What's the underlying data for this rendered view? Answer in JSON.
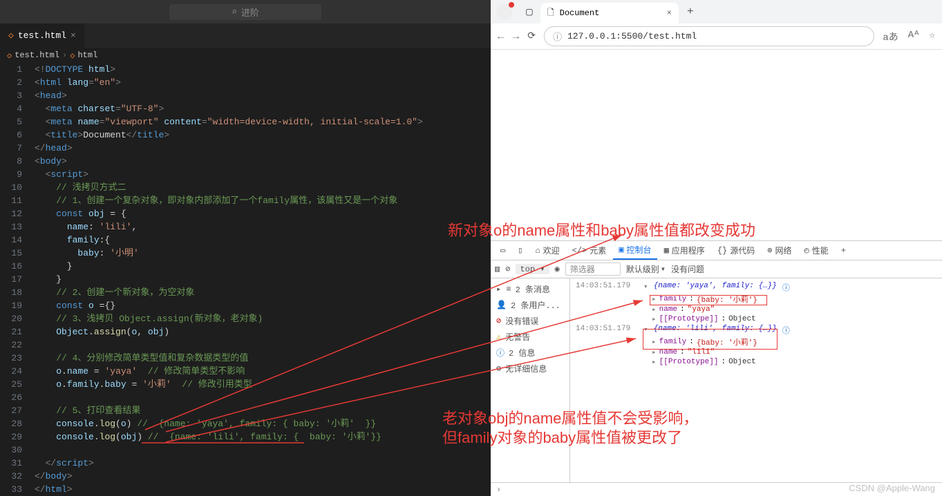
{
  "vscode": {
    "search_placeholder": "进阶",
    "tab_name": "test.html",
    "breadcrumb": [
      "test.html",
      "html"
    ],
    "code_lines": [
      {
        "n": 1,
        "html": "<span class='punc'>&lt;!</span><span class='tag'>DOCTYPE</span> <span class='attr'>html</span><span class='punc'>&gt;</span>"
      },
      {
        "n": 2,
        "html": "<span class='punc'>&lt;</span><span class='tag'>html</span> <span class='attr'>lang</span><span class='punc'>=</span><span class='str'>\"en\"</span><span class='punc'>&gt;</span>"
      },
      {
        "n": 3,
        "html": "<span class='punc'>&lt;</span><span class='tag'>head</span><span class='punc'>&gt;</span>"
      },
      {
        "n": 4,
        "html": "  <span class='punc'>&lt;</span><span class='tag'>meta</span> <span class='attr'>charset</span><span class='punc'>=</span><span class='str'>\"UTF-8\"</span><span class='punc'>&gt;</span>"
      },
      {
        "n": 5,
        "html": "  <span class='punc'>&lt;</span><span class='tag'>meta</span> <span class='attr'>name</span><span class='punc'>=</span><span class='str'>\"viewport\"</span> <span class='attr'>content</span><span class='punc'>=</span><span class='str'>\"width=device-width, initial-scale=1.0\"</span><span class='punc'>&gt;</span>"
      },
      {
        "n": 6,
        "html": "  <span class='punc'>&lt;</span><span class='tag'>title</span><span class='punc'>&gt;</span>Document<span class='punc'>&lt;/</span><span class='tag'>title</span><span class='punc'>&gt;</span>"
      },
      {
        "n": 7,
        "html": "<span class='punc'>&lt;/</span><span class='tag'>head</span><span class='punc'>&gt;</span>"
      },
      {
        "n": 8,
        "html": "<span class='punc'>&lt;</span><span class='tag'>body</span><span class='punc'>&gt;</span>"
      },
      {
        "n": 9,
        "html": "  <span class='punc'>&lt;</span><span class='tag'>script</span><span class='punc'>&gt;</span>"
      },
      {
        "n": 10,
        "html": "    <span class='cmt'>// 浅拷贝方式二</span>"
      },
      {
        "n": 11,
        "html": "    <span class='cmt'>// 1、创建一个复杂对象，即对象内部添加了一个family属性，该属性又是一个对象</span>"
      },
      {
        "n": 12,
        "html": "    <span class='const'>const</span> <span class='var'>obj</span> = {"
      },
      {
        "n": 13,
        "html": "      <span class='prop'>name</span>: <span class='str'>'lili'</span>,"
      },
      {
        "n": 14,
        "html": "      <span class='prop'>family</span>:{"
      },
      {
        "n": 15,
        "html": "        <span class='prop'>baby</span>: <span class='str'>'小明'</span>"
      },
      {
        "n": 16,
        "html": "      }"
      },
      {
        "n": 17,
        "html": "    }"
      },
      {
        "n": 18,
        "html": "    <span class='cmt'>// 2、创建一个新对象，为空对象</span>"
      },
      {
        "n": 19,
        "html": "    <span class='const'>const</span> <span class='var'>o</span> ={}"
      },
      {
        "n": 20,
        "html": "    <span class='cmt'>// 3、浅拷贝 Object.assign(新对象，老对象)</span>"
      },
      {
        "n": 21,
        "html": "    <span class='var'>Object</span>.<span class='fn'>assign</span>(<span class='var'>o</span>, <span class='var'>obj</span>)"
      },
      {
        "n": 22,
        "html": ""
      },
      {
        "n": 23,
        "html": "    <span class='cmt'>// 4、分别修改简单类型值和复杂数据类型的值</span>"
      },
      {
        "n": 24,
        "html": "    <span class='var'>o</span>.<span class='prop'>name</span> = <span class='str'>'yaya'</span>  <span class='cmt'>// 修改简单类型不影响</span>"
      },
      {
        "n": 25,
        "html": "    <span class='var'>o</span>.<span class='prop'>family</span>.<span class='prop'>baby</span> = <span class='str'>'小莉'</span>  <span class='cmt'>// 修改引用类型</span>"
      },
      {
        "n": 26,
        "html": ""
      },
      {
        "n": 27,
        "html": "    <span class='cmt'>// 5、打印查看结果</span>"
      },
      {
        "n": 28,
        "html": "    <span class='var'>console</span>.<span class='fn'>log</span>(<span class='var'>o</span>) <span class='cmt'>//  {name: 'yaya', family: { baby: '小莉'  }}</span>"
      },
      {
        "n": 29,
        "html": "    <span class='var'>console</span>.<span class='fn'>log</span>(<span class='var'>obj</span>) <span class='cmt'>//  {name: 'lili', family: {  baby: '小莉'}}</span>"
      },
      {
        "n": 30,
        "html": ""
      },
      {
        "n": 31,
        "html": "  <span class='punc'>&lt;/</span><span class='tag'>script</span><span class='punc'>&gt;</span>"
      },
      {
        "n": 32,
        "html": "<span class='punc'>&lt;/</span><span class='tag'>body</span><span class='punc'>&gt;</span>"
      },
      {
        "n": 33,
        "html": "<span class='punc'>&lt;/</span><span class='tag'>html</span><span class='punc'>&gt;</span>"
      }
    ]
  },
  "browser": {
    "tab_title": "Document",
    "url": "127.0.0.1:5500/test.html",
    "reader_mode": "aあ"
  },
  "devtools": {
    "tabs": [
      "欢迎",
      "元素",
      "控制台",
      "应用程序",
      "源代码",
      "网络",
      "性能"
    ],
    "active_tab": 2,
    "toolbar": {
      "top": "top",
      "filter": "筛选器",
      "levels": "默认级别",
      "issues": "没有问题"
    },
    "sidebar": [
      {
        "icon": "≡",
        "text": "2 条消息"
      },
      {
        "icon": "👤",
        "text": "2 条用户..."
      },
      {
        "icon": "⊘",
        "text": "没有错误",
        "color": "#c00"
      },
      {
        "icon": "⚠",
        "text": "无警告",
        "color": "#c90"
      },
      {
        "icon": "ⓘ",
        "text": "2 信息",
        "color": "#06c"
      },
      {
        "icon": "⚙",
        "text": "无详细信息"
      }
    ],
    "console": [
      {
        "ts": "14:03:51.179",
        "summary": "{name: 'yaya', family: {…}}",
        "details": [
          "family: {baby: '小莉'}",
          "name: \"yaya\"",
          "[[Prototype]]: Object"
        ]
      },
      {
        "ts": "14:03:51.179",
        "summary": "{name: 'lili', family: {…}}",
        "details": [
          "family: {baby: '小莉'}",
          "name: \"lili\"",
          "[[Prototype]]: Object"
        ]
      }
    ]
  },
  "annotations": {
    "top": "新对象o的name属性和baby属性值都改变成功",
    "bottom1": "老对象obj的name属性值不会受影响，",
    "bottom2": "但family对象的baby属性值被更改了"
  },
  "watermark": "CSDN @Apple-Wang"
}
